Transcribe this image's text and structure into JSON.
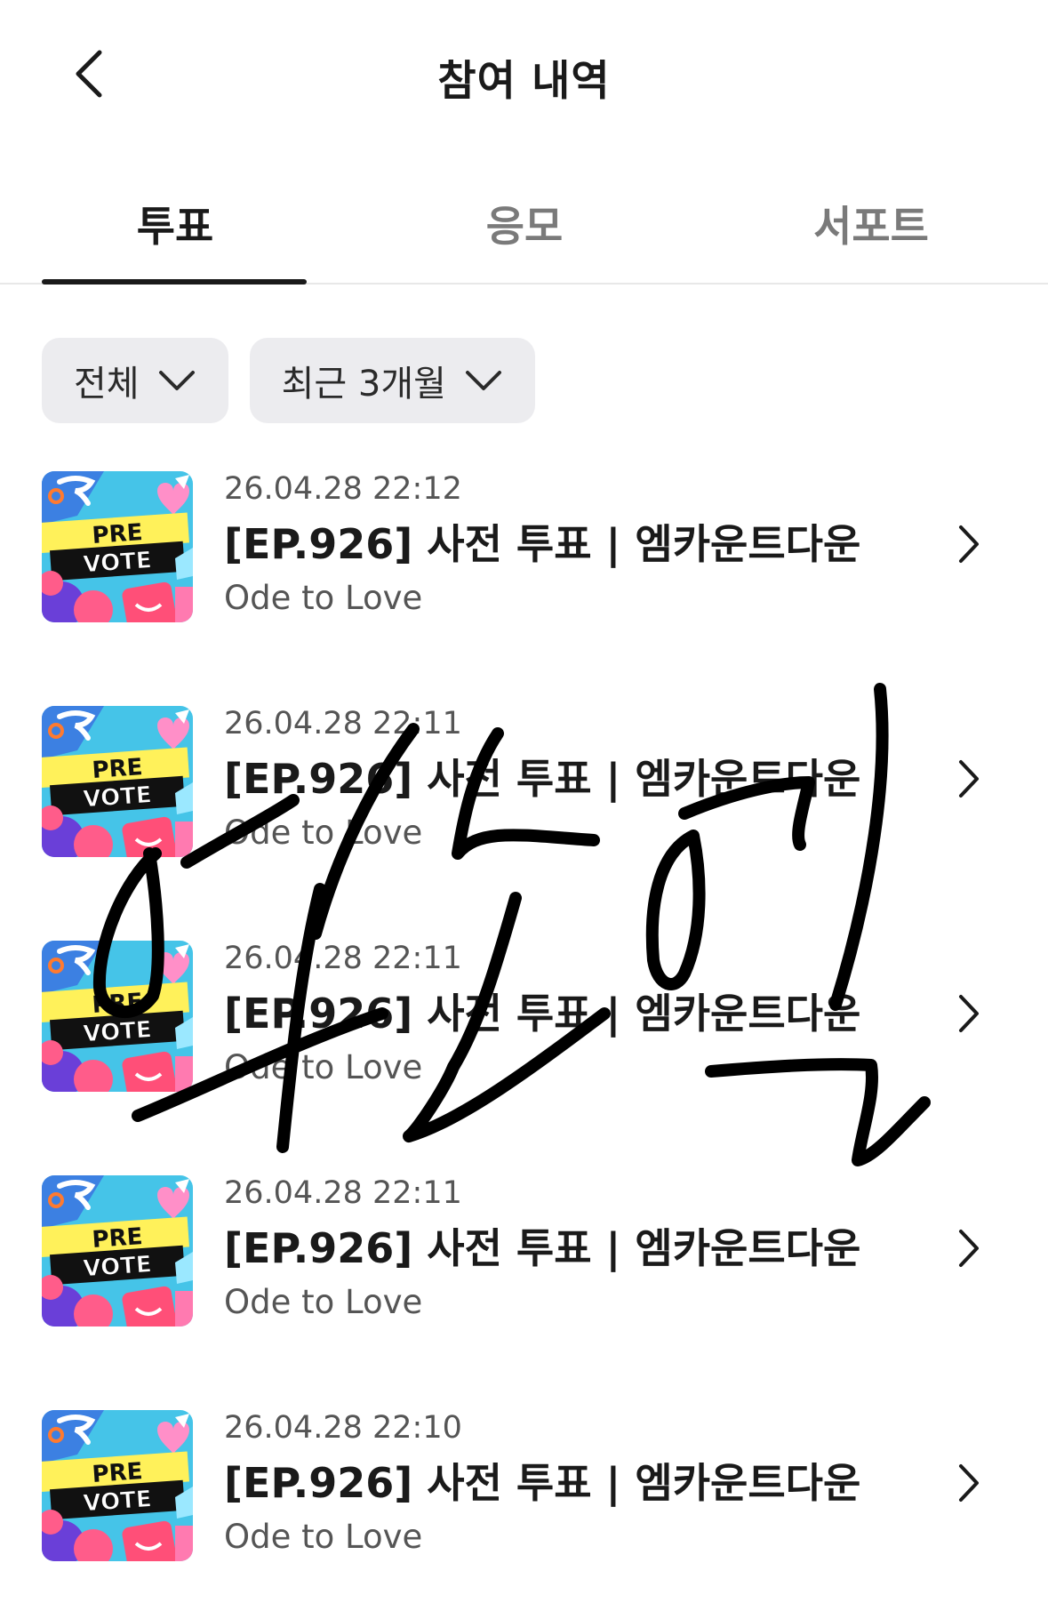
{
  "header": {
    "title": "참여 내역"
  },
  "tabs": [
    {
      "label": "투표",
      "active": true
    },
    {
      "label": "응모",
      "active": false
    },
    {
      "label": "서포트",
      "active": false
    }
  ],
  "filters": [
    {
      "label": "전체"
    },
    {
      "label": "최근 3개월"
    }
  ],
  "thumbnail": {
    "line1": "PRE",
    "line2": "VOTE"
  },
  "items": [
    {
      "date": "26.04.28 22:12",
      "title": "[EP.926] 사전 투표 | 엠카운트다운",
      "subtitle": "Ode to Love"
    },
    {
      "date": "26.04.28 22:11",
      "title": "[EP.926] 사전 투표 | 엠카운트다운",
      "subtitle": "Ode to Love"
    },
    {
      "date": "26.04.28 22:11",
      "title": "[EP.926] 사전 투표 | 엠카운트다운",
      "subtitle": "Ode to Love"
    },
    {
      "date": "26.04.28 22:11",
      "title": "[EP.926] 사전 투표 | 엠카운트다운",
      "subtitle": "Ode to Love"
    },
    {
      "date": "26.04.28 22:10",
      "title": "[EP.926] 사전 투표 | 엠카운트다운",
      "subtitle": "Ode to Love"
    }
  ],
  "colors": {
    "accent": "#1a1a1a",
    "muted": "#7a7a7a",
    "chip_bg": "#ececef",
    "thumb_bg": "#45c4e8",
    "thumb_yellow": "#fff15a",
    "thumb_pink": "#ff5c8a"
  }
}
